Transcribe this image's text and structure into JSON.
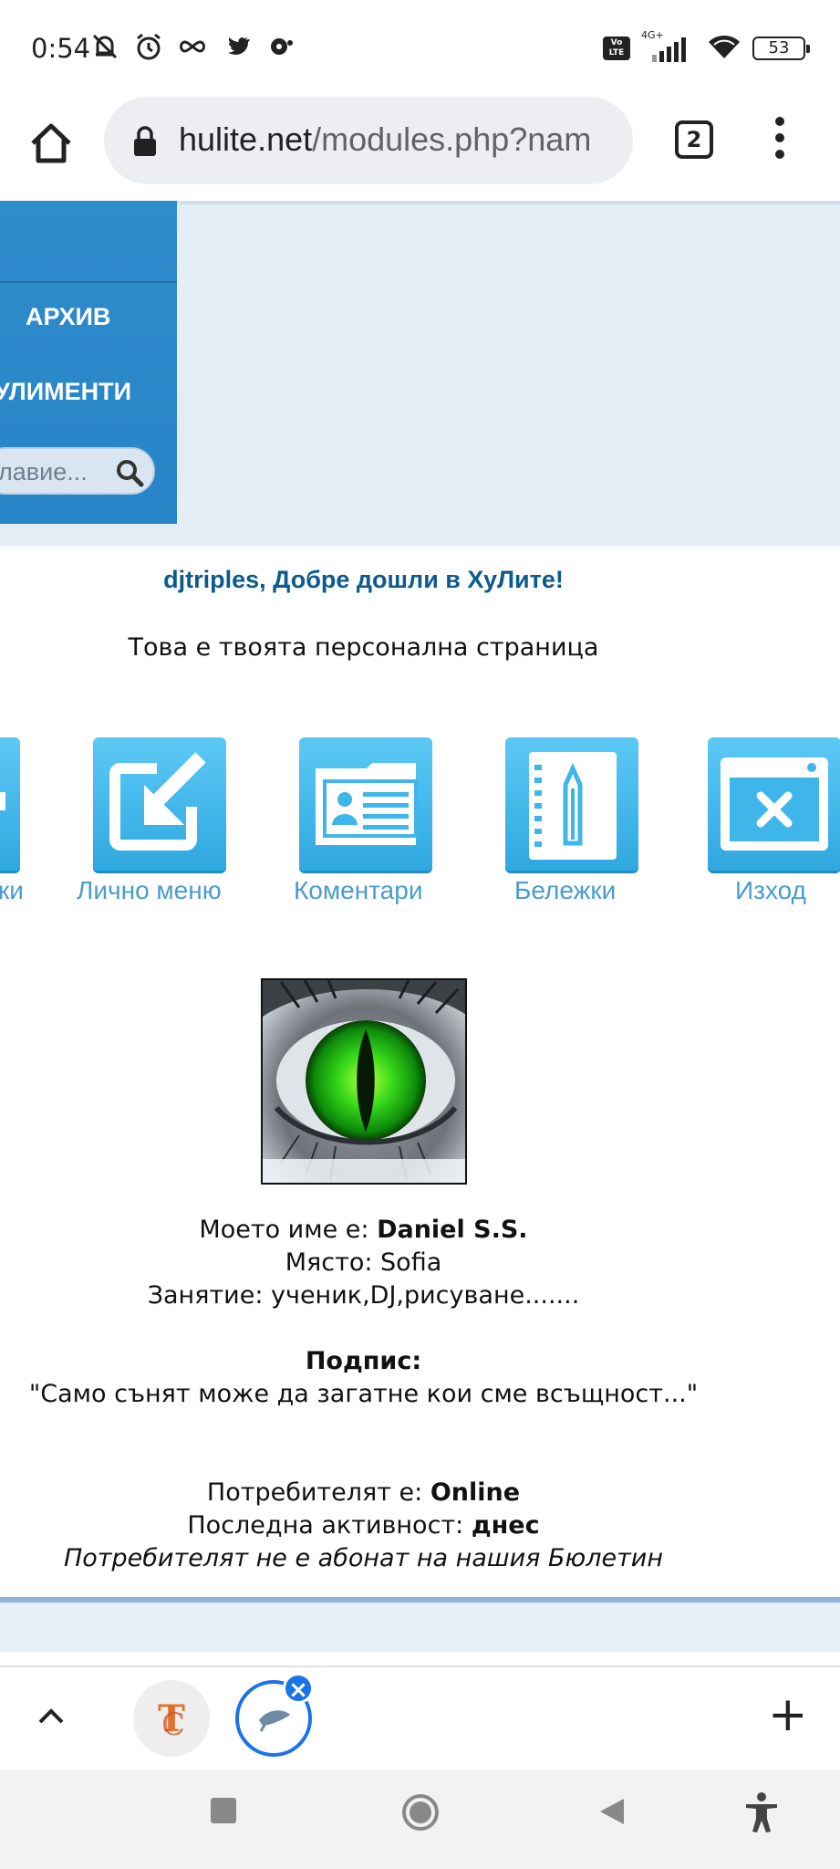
{
  "status_bar": {
    "time": "0:54",
    "volte_label": "Vo LTE",
    "network": "4G+",
    "battery": "53"
  },
  "browser": {
    "url_host": "hulite.net",
    "url_path": "/modules.php?nam",
    "tab_count": "2"
  },
  "nav": {
    "items": [
      {
        "label": "АРХИВ"
      },
      {
        "label": "УЛИМЕНТИ"
      }
    ],
    "search_placeholder": "лавие..."
  },
  "welcome": {
    "title": "djtriples, Добре дошли в ХуЛите!",
    "subtitle": "Това е твоята персонална страница"
  },
  "menu_icons": [
    {
      "label": "ки",
      "icon": "arrow-icon"
    },
    {
      "label": "Лично меню",
      "icon": "personal-menu-icon"
    },
    {
      "label": "Коментари",
      "icon": "id-card-icon"
    },
    {
      "label": "Бележки",
      "icon": "notebook-pencil-icon"
    },
    {
      "label": "Изход",
      "icon": "close-window-icon"
    }
  ],
  "profile": {
    "name_prefix": "Моето име е: ",
    "name": "Daniel S.S.",
    "place_prefix": "Място: ",
    "place": "Sofia",
    "occupation_prefix": "Занятие: ",
    "occupation": "ученик,DJ,рисуване.......",
    "signature_label": "Подпис:",
    "signature": "\"Само сънят може да загатне кои сме всъщност...\"",
    "status_prefix": "Потребителят е: ",
    "status": "Online",
    "last_active_prefix": "Последна активност: ",
    "last_active": "днес",
    "newsletter": "Потребителят не е абонат на нашия Бюлетин"
  },
  "colors": {
    "nav_blue": "#2f8ccd",
    "welcome_text": "#0c5b8c",
    "icon_tile": "#3fb6ea",
    "icon_label": "#4a9ccc",
    "tab_active": "#1a73e8"
  }
}
